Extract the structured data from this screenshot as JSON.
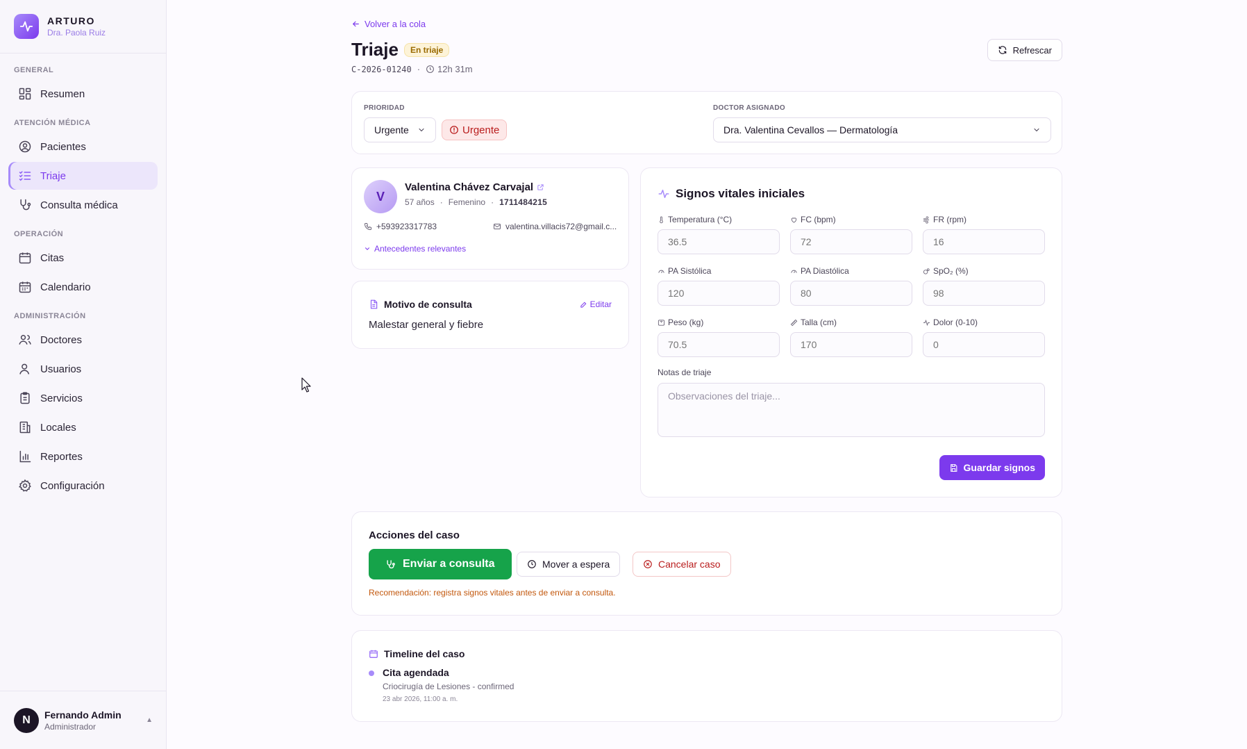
{
  "brand": {
    "name": "ARTURO",
    "subtitle": "Dra. Paola Ruiz"
  },
  "sidebar": {
    "sections": [
      {
        "title": "GENERAL",
        "items": [
          {
            "label": "Resumen",
            "icon": "dashboard-icon"
          }
        ]
      },
      {
        "title": "ATENCIÓN MÉDICA",
        "items": [
          {
            "label": "Pacientes",
            "icon": "user-circle-icon"
          },
          {
            "label": "Triaje",
            "icon": "list-check-icon",
            "active": true
          },
          {
            "label": "Consulta médica",
            "icon": "stethoscope-icon"
          }
        ]
      },
      {
        "title": "OPERACIÓN",
        "items": [
          {
            "label": "Citas",
            "icon": "calendar-icon"
          },
          {
            "label": "Calendario",
            "icon": "calendar-grid-icon"
          }
        ]
      },
      {
        "title": "ADMINISTRACIÓN",
        "items": [
          {
            "label": "Doctores",
            "icon": "users-icon"
          },
          {
            "label": "Usuarios",
            "icon": "user-icon"
          },
          {
            "label": "Servicios",
            "icon": "clipboard-icon"
          },
          {
            "label": "Locales",
            "icon": "building-icon"
          },
          {
            "label": "Reportes",
            "icon": "bar-chart-icon"
          },
          {
            "label": "Configuración",
            "icon": "gear-icon"
          }
        ]
      }
    ]
  },
  "user": {
    "initial": "N",
    "name": "Fernando Admin",
    "role": "Administrador"
  },
  "header": {
    "back_label": "Volver a la cola",
    "title": "Triaje",
    "status_badge": "En triaje",
    "case_code": "C-2026-01240",
    "elapsed": "12h 31m",
    "refresh_label": "Refrescar"
  },
  "priority": {
    "label": "PRIORIDAD",
    "selected": "Urgente",
    "pill": "Urgente",
    "doctor_label": "DOCTOR ASIGNADO",
    "doctor_selected": "Dra. Valentina Cevallos — Dermatología"
  },
  "patient": {
    "initial": "V",
    "name": "Valentina Chávez Carvajal",
    "age": "57 años",
    "sex": "Femenino",
    "id_number": "1711484215",
    "phone": "+593923317783",
    "email": "valentina.villacis72@gmail.c...",
    "antecedentes_label": "Antecedentes relevantes"
  },
  "motivo": {
    "title": "Motivo de consulta",
    "edit_label": "Editar",
    "text": "Malestar general y fiebre"
  },
  "vitals": {
    "title": "Signos vitales iniciales",
    "fields": [
      {
        "label": "Temperatura (°C)",
        "placeholder": "36.5",
        "icon": "thermometer-icon"
      },
      {
        "label": "FC (bpm)",
        "placeholder": "72",
        "icon": "heart-icon"
      },
      {
        "label": "FR (rpm)",
        "placeholder": "16",
        "icon": "wind-icon"
      },
      {
        "label": "PA Sistólica",
        "placeholder": "120",
        "icon": "gauge-icon"
      },
      {
        "label": "PA Diastólica",
        "placeholder": "80",
        "icon": "gauge-icon"
      },
      {
        "label": "SpO₂ (%)",
        "placeholder": "98",
        "icon": "oxygen-icon"
      },
      {
        "label": "Peso (kg)",
        "placeholder": "70.5",
        "icon": "scale-icon"
      },
      {
        "label": "Talla (cm)",
        "placeholder": "170",
        "icon": "ruler-icon"
      },
      {
        "label": "Dolor (0-10)",
        "placeholder": "0",
        "icon": "activity-icon"
      }
    ],
    "notes_label": "Notas de triaje",
    "notes_placeholder": "Observaciones del triaje...",
    "save_label": "Guardar signos"
  },
  "actions": {
    "title": "Acciones del caso",
    "send_label": "Enviar a consulta",
    "wait_label": "Mover a espera",
    "cancel_label": "Cancelar caso",
    "recommendation": "Recomendación: registra signos vitales antes de enviar a consulta."
  },
  "timeline": {
    "title": "Timeline del caso",
    "events": [
      {
        "title": "Cita agendada",
        "description": "Criocirugía de Lesiones - confirmed",
        "date": "23 abr 2026, 11:00 a. m."
      }
    ]
  },
  "colors": {
    "accent": "#7c3aed",
    "success": "#16a34a",
    "danger": "#b91c1c",
    "warning": "#c2570c"
  }
}
